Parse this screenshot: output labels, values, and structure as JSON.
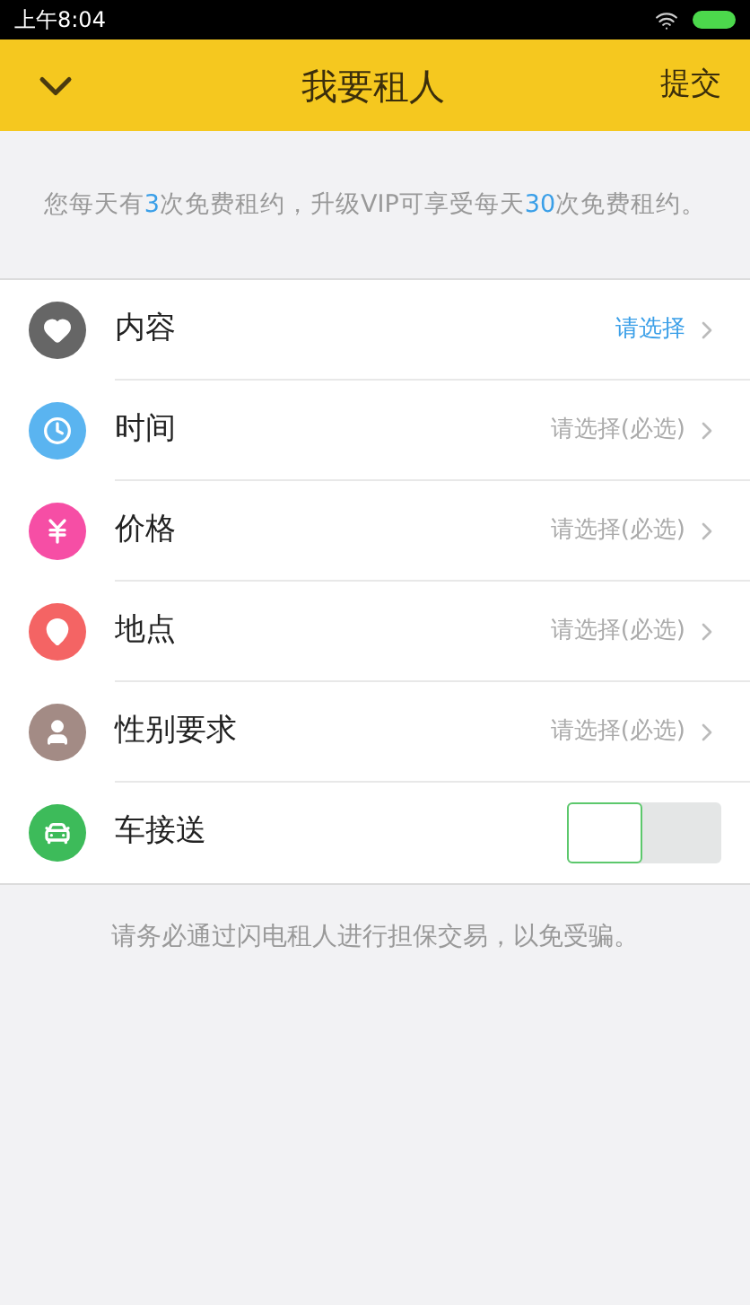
{
  "status_bar": {
    "time": "上午8:04"
  },
  "header": {
    "title": "我要租人",
    "action": "提交"
  },
  "notice": "您每天有**3**次免费租约，升级VIP可享受每天**30**次免费租约。",
  "rows": [
    {
      "kind": "select",
      "label": "内容",
      "color": "#666666",
      "value": "请选择",
      "highlight": true
    },
    {
      "kind": "select",
      "label": "时间",
      "color": "#5ab4f0",
      "value": "请选择(必选)",
      "highlight": false
    },
    {
      "kind": "select",
      "label": "价格",
      "color": "#f64ea5",
      "value": "请选择(必选)",
      "highlight": false
    },
    {
      "kind": "select",
      "label": "地点",
      "color": "#f46464",
      "value": "请选择(必选)",
      "highlight": false
    },
    {
      "kind": "select",
      "label": "性别要求",
      "color": "#a38b85",
      "value": "请选择(必选)",
      "highlight": false
    },
    {
      "kind": "toggle",
      "label": "车接送",
      "color": "#3dbb5a",
      "on": false
    }
  ],
  "footer": "请务必通过闪电租人进行担保交易，以免受骗。"
}
